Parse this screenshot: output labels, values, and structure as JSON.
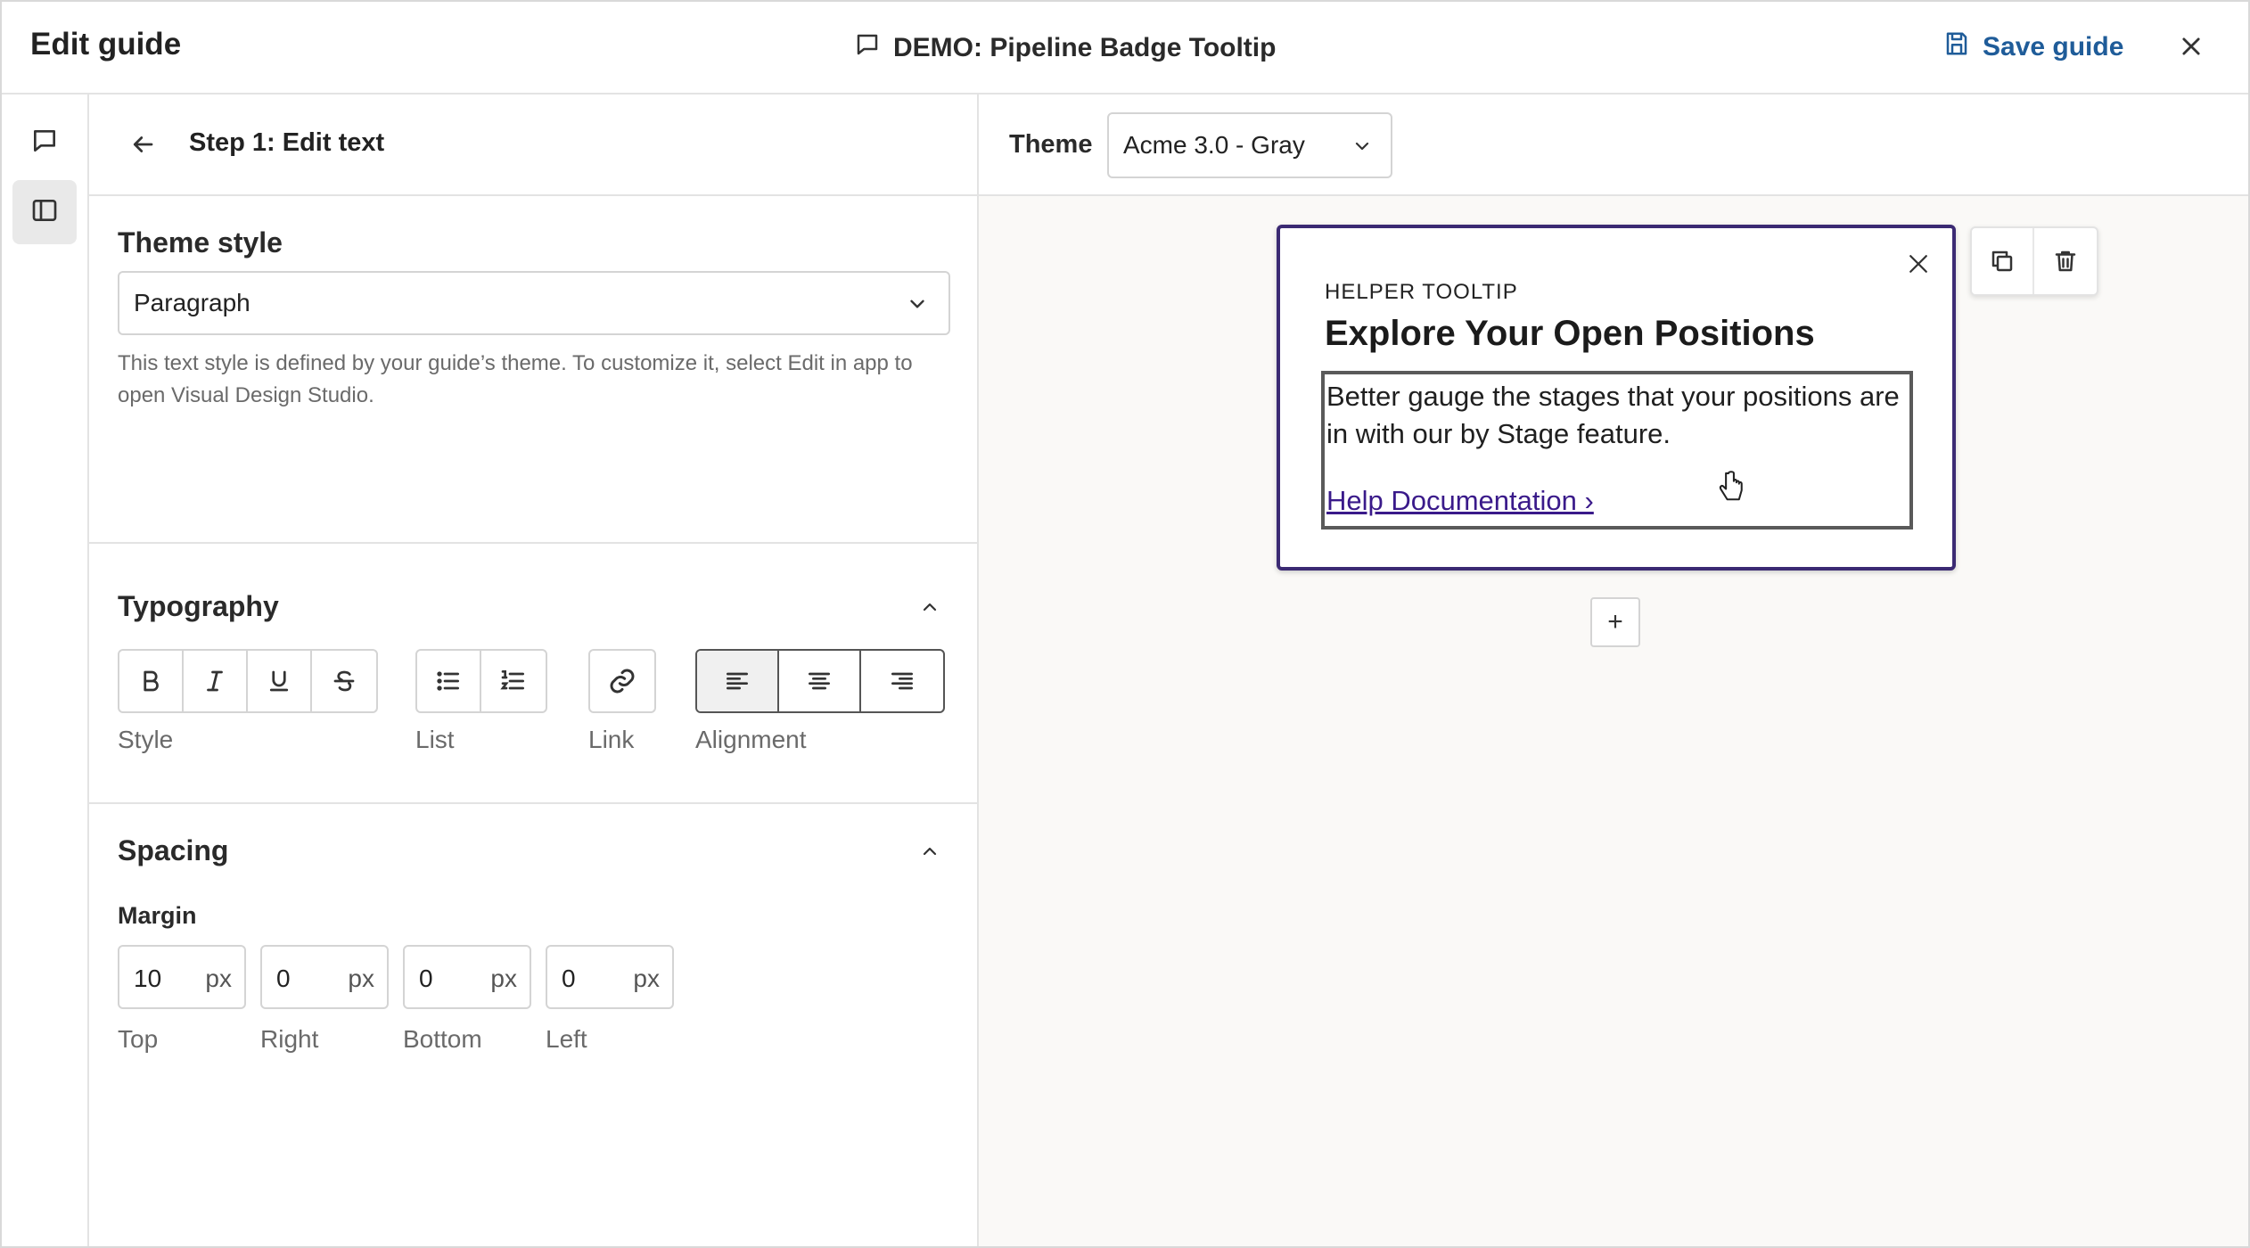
{
  "header": {
    "title": "Edit guide",
    "guide_name": "DEMO: Pipeline Badge Tooltip",
    "save_label": "Save guide",
    "accent_color": "#1f5c99"
  },
  "rail": {
    "items": [
      {
        "icon": "comment-icon",
        "active": false
      },
      {
        "icon": "sidebar-panel-icon",
        "active": true
      }
    ]
  },
  "panel": {
    "step_title": "Step 1: Edit text",
    "theme_style": {
      "heading": "Theme style",
      "selected": "Paragraph",
      "help": "This text style is defined by your guide’s theme. To customize it, select Edit in app to open Visual Design Studio."
    },
    "typography": {
      "heading": "Typography",
      "style_label": "Style",
      "list_label": "List",
      "link_label": "Link",
      "alignment_label": "Alignment",
      "active_alignment": "left"
    },
    "spacing": {
      "heading": "Spacing",
      "margin_label": "Margin",
      "fields": [
        {
          "value": "10",
          "unit": "px",
          "label": "Top"
        },
        {
          "value": "0",
          "unit": "px",
          "label": "Right"
        },
        {
          "value": "0",
          "unit": "px",
          "label": "Bottom"
        },
        {
          "value": "0",
          "unit": "px",
          "label": "Left"
        }
      ]
    }
  },
  "canvas": {
    "theme_label": "Theme",
    "theme_selected": "Acme 3.0 - Gray",
    "tooltip": {
      "label": "HELPER TOOLTIP",
      "heading": "Explore Your Open Positions",
      "body": "Better gauge the stages that your positions are in with our by Stage feature.",
      "link": "Help Documentation ›",
      "border_color": "#3b2a73",
      "link_color": "#3a1a8a"
    },
    "add_label": "+"
  }
}
